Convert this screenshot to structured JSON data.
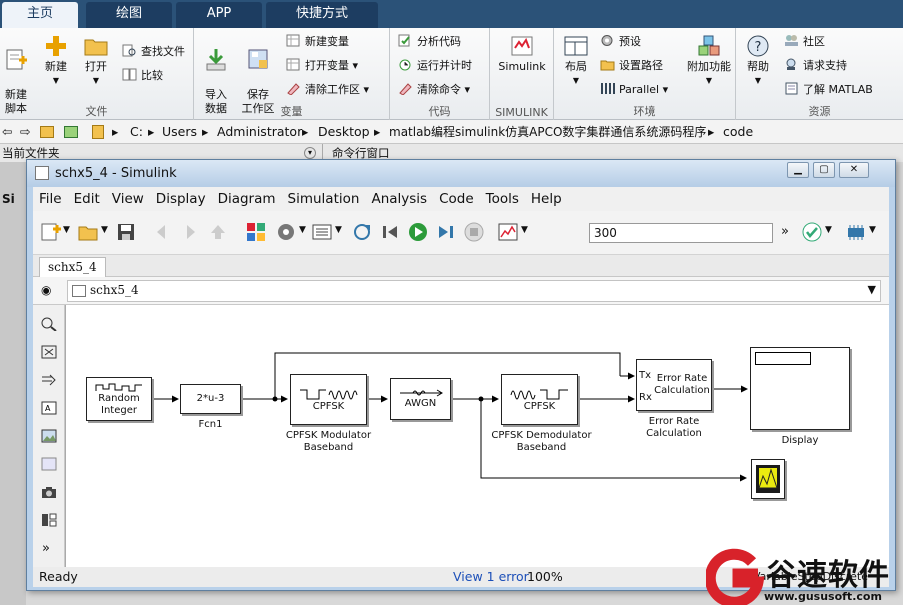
{
  "matlab": {
    "tabs": [
      "主页",
      "绘图",
      "APP",
      "快捷方式"
    ],
    "ribbon": {
      "file": {
        "group": "文件",
        "new_script": "新建\n脚本",
        "new": "新建",
        "open": "打开",
        "find_files": "查找文件",
        "compare": "比较"
      },
      "variable": {
        "group": "变量",
        "import": "导入\n数据",
        "save_ws": "保存\n工作区",
        "new_var": "新建变量",
        "open_var": "打开变量",
        "clear_ws": "清除工作区"
      },
      "code": {
        "group": "代码",
        "analyze": "分析代码",
        "run_time": "运行并计时",
        "clear_cmd": "清除命令"
      },
      "simulink": {
        "group": "SIMULINK",
        "simulink": "Simulink"
      },
      "env": {
        "group": "环境",
        "layout": "布局",
        "prefs": "预设",
        "set_path": "设置路径",
        "parallel": "Parallel",
        "addons": "附加功能"
      },
      "resources": {
        "group": "资源",
        "help": "帮助",
        "community": "社区",
        "request_support": "请求支持",
        "learn": "了解 MATLAB"
      }
    },
    "path": [
      "C:",
      "Users",
      "Administrator",
      "Desktop",
      "matlab编程simulink仿真APCO数字集群通信系统源码程序",
      "code"
    ],
    "current_folder": "当前文件夹",
    "command_window": "命令行窗口",
    "side_text": "Si"
  },
  "simulink": {
    "title": "schx5_4 - Simulink",
    "menus": [
      "File",
      "Edit",
      "View",
      "Display",
      "Diagram",
      "Simulation",
      "Analysis",
      "Code",
      "Tools",
      "Help"
    ],
    "stop_time": "300",
    "tab": "schx5_4",
    "breadcrumb": "schx5_4",
    "status_left": "Ready",
    "status_mid": "View 1 error",
    "zoom": "100%",
    "status_right": "VariableStepDiscrete"
  },
  "blocks": {
    "random_integer": "Random\nInteger",
    "fcn_expr": "2*u-3",
    "fcn_label": "Fcn1",
    "mod_text": "CPFSK",
    "mod_label": "CPFSK Modulator\nBaseband",
    "awgn": "AWGN",
    "demod_text": "CPFSK",
    "demod_label": "CPFSK Demodulator\nBaseband",
    "err_tx": "Tx",
    "err_rx": "Rx",
    "err_body": "Error Rate\nCalculation",
    "err_label": "Error Rate\nCalculation",
    "display_label": "Display"
  },
  "watermark": {
    "name": "谷速软件",
    "url": "www.gususoft.com"
  }
}
